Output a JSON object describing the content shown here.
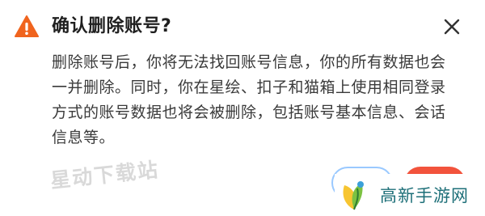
{
  "dialog": {
    "title": "确认删除账号?",
    "message": "删除账号后，你将无法找回账号信息，你的所有数据也会一并删除。同时，你在星绘、扣子和猫箱上使用相同登录方式的账号数据也将会被删除，包括账号基本信息、会话信息等。",
    "warn_icon": "warning-triangle-icon",
    "close_icon": "close-icon",
    "colors": {
      "warning": "#f0641e",
      "confirm": "#f2533c",
      "cancel_border": "#9ac9ff"
    }
  },
  "watermark": {
    "text": "星动下载站"
  },
  "brand": {
    "text": "高新手游网",
    "logo_icon": "leaf-logo-icon"
  }
}
